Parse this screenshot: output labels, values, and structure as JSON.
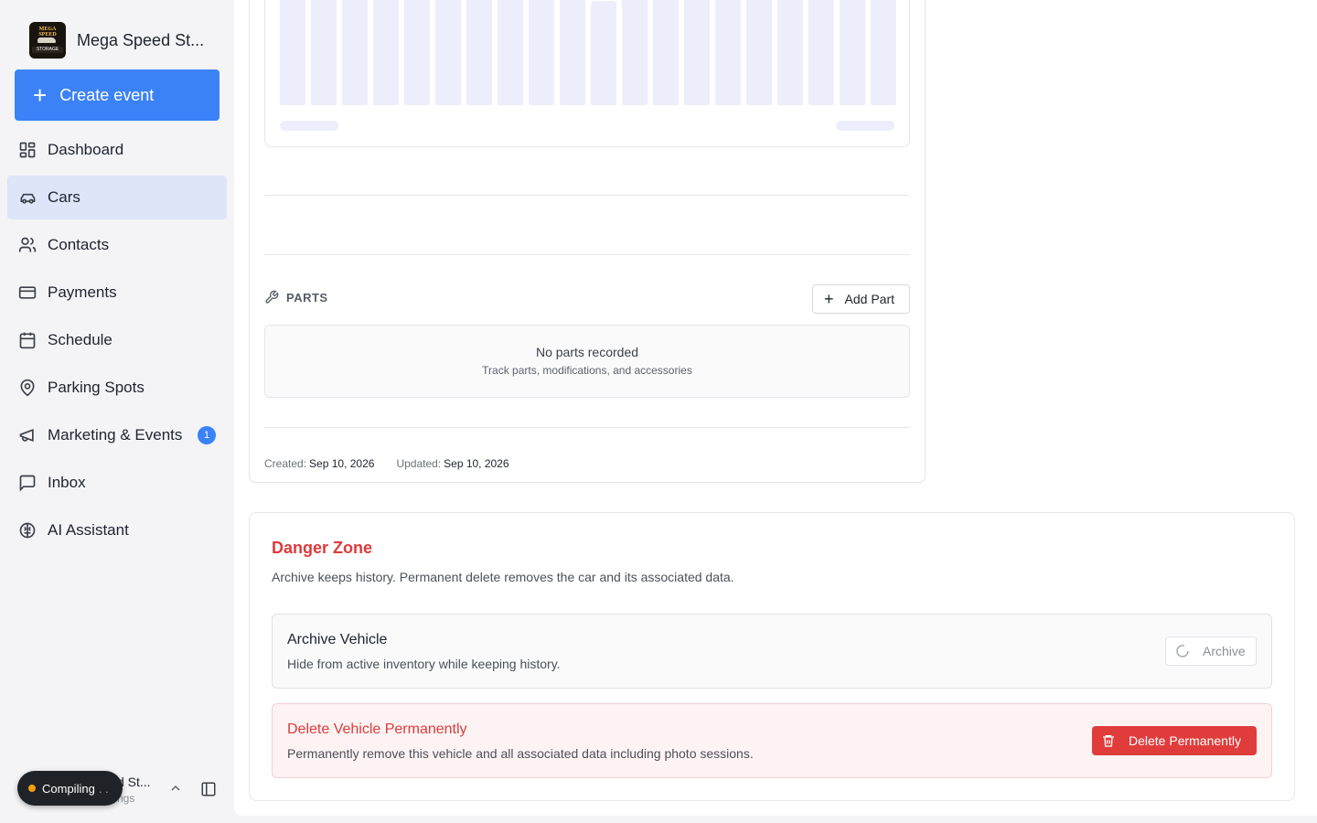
{
  "app": {
    "name": "Mega Speed St...",
    "logo_text_top": "MEGA SPEED",
    "logo_text_bottom": "STORAGE"
  },
  "sidebar": {
    "create_label": "Create event",
    "items": [
      {
        "label": "Dashboard",
        "icon": "dashboard-icon"
      },
      {
        "label": "Cars",
        "icon": "car-icon",
        "active": true
      },
      {
        "label": "Contacts",
        "icon": "users-icon"
      },
      {
        "label": "Payments",
        "icon": "credit-card-icon"
      },
      {
        "label": "Schedule",
        "icon": "calendar-icon"
      },
      {
        "label": "Parking Spots",
        "icon": "map-pin-icon"
      },
      {
        "label": "Marketing & Events",
        "icon": "megaphone-icon",
        "badge": "1"
      },
      {
        "label": "Inbox",
        "icon": "message-square-icon"
      },
      {
        "label": "AI Assistant",
        "icon": "brain-icon"
      }
    ],
    "account": {
      "name": "d St...",
      "sub": "ngs"
    },
    "status": {
      "label": "Compiling",
      "dots": ". ."
    }
  },
  "chart": {
    "bar_levels": [
      0.9,
      1.0,
      1.0,
      1.0,
      1.0,
      1.0,
      0.99,
      1.0,
      1.0,
      1.0,
      0.85,
      1.0,
      1.0,
      1.0,
      1.0,
      1.0,
      1.0,
      1.0,
      1.0,
      1.0
    ]
  },
  "parts": {
    "heading": "PARTS",
    "add_label": "Add Part",
    "empty_title": "No parts recorded",
    "empty_sub": "Track parts, modifications, and accessories"
  },
  "meta": {
    "created_label": "Created:",
    "created_value": "Sep 10, 2026",
    "updated_label": "Updated:",
    "updated_value": "Sep 10, 2026"
  },
  "danger_zone": {
    "title": "Danger Zone",
    "description": "Archive keeps history. Permanent delete removes the car and its associated data.",
    "archive": {
      "title": "Archive Vehicle",
      "description": "Hide from active inventory while keeping history.",
      "button": "Archive"
    },
    "delete": {
      "title": "Delete Vehicle Permanently",
      "description": "Permanently remove this vehicle and all associated data including photo sessions.",
      "button": "Delete Permanently"
    }
  },
  "colors": {
    "accent": "#3b82f6",
    "danger": "#dc3b3b",
    "status_dot": "#f59e0b"
  }
}
